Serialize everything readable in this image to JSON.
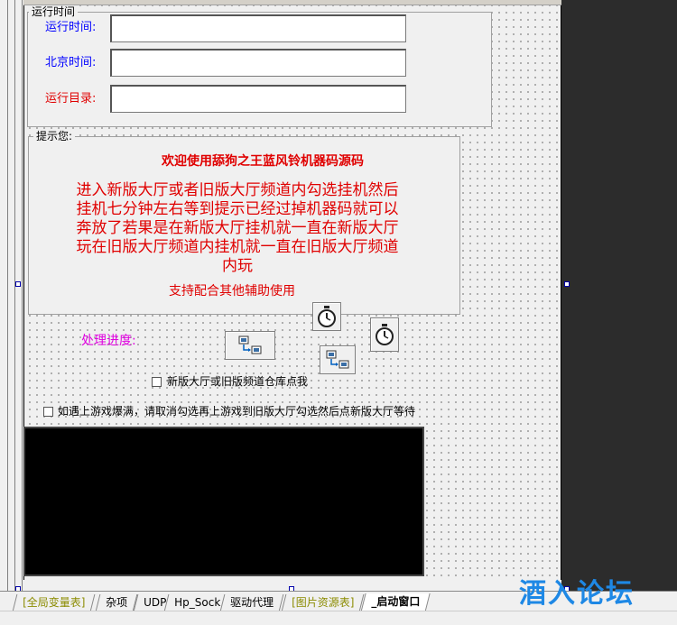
{
  "run_group": {
    "title": "运行时间",
    "run_time_label": "运行时间:",
    "beijing_time_label": "北京时间:",
    "run_dir_label": "运行目录:"
  },
  "tips": {
    "title": "提示您:",
    "welcome": "欢迎使用舔狗之王蓝风铃机器码源码",
    "body_lines": [
      "进入新版大厅或者旧版大厅频道内勾选挂机然后",
      "挂机七分钟左右等到提示已经过掉机器码就可以",
      "奔放了若果是在新版大厅挂机就一直在新版大厅",
      "玩在旧版大厅频道内挂机就一直在旧版大厅频道",
      "内玩"
    ],
    "footer": "支持配合其他辅助使用"
  },
  "progress_label": "处理进度:",
  "checkbox1": "新版大厅或旧版频道仓库点我",
  "checkbox2": "如遇上游戏爆满，请取消勾选再上游戏到旧版大厅勾选然后点新版大厅等待",
  "tabs": [
    "[全局变量表]",
    "杂项",
    "UDP",
    "Hp_Sock",
    "驱动代理",
    "[图片资源表]",
    "_启动窗口"
  ],
  "watermark": "酒入论坛",
  "icons": {
    "timer": "stopwatch-icon",
    "net": "network-transfer-icon"
  },
  "colors": {
    "label_blue": "#0000ff",
    "label_red": "#e00000",
    "progress_magenta": "#e000e0",
    "watermark_blue": "#1e88e5"
  }
}
